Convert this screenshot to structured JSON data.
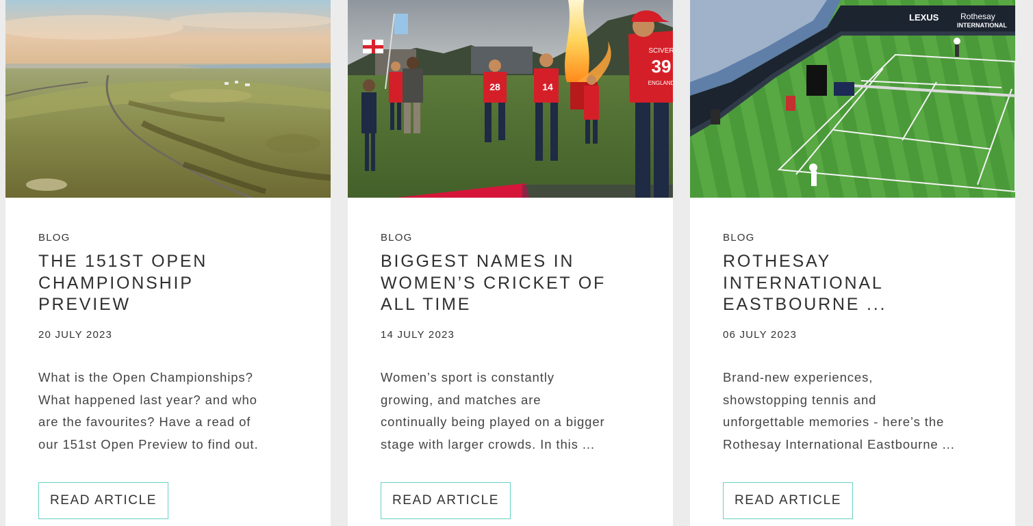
{
  "cards": [
    {
      "category": "BLOG",
      "title_lines": [
        "THE 151ST OPEN",
        "CHAMPIONSHIP",
        "PREVIEW"
      ],
      "date": "20 JULY 2023",
      "excerpt_lines": [
        "What is the Open Championships?",
        "What happened last year? and who",
        "are the favourites? Have a read of",
        "our 151st Open Preview to find out."
      ],
      "button_label": "READ ARTICLE",
      "image_icon": "golf-links-aerial-photo"
    },
    {
      "category": "BLOG",
      "title_lines": [
        "BIGGEST NAMES IN",
        "WOMEN’S CRICKET OF",
        "ALL TIME"
      ],
      "date": "14 JULY 2023",
      "excerpt_lines": [
        "Women’s sport is constantly",
        "growing, and matches are",
        "continually being played on a bigger",
        "stage with larger crowds. In this ..."
      ],
      "button_label": "READ ARTICLE",
      "image_icon": "cricket-players-walkout-photo"
    },
    {
      "category": "BLOG",
      "title_lines": [
        "ROTHESAY",
        "INTERNATIONAL",
        "EASTBOURNE ..."
      ],
      "date": "06 JULY 2023",
      "excerpt_lines": [
        "Brand-new experiences,",
        "showstopping tennis and",
        "unforgettable memories - here’s the",
        "Rothesay International Eastbourne ..."
      ],
      "button_label": "READ ARTICLE",
      "image_icon": "tennis-court-aerial-photo",
      "image_text": {
        "sponsor_left": "LEXUS",
        "sponsor_right_1": "Rothesay",
        "sponsor_right_2": "INTERNATIONAL",
        "shirt_number": "39",
        "shirt_name": "SCIVER",
        "shirt_country": "ENGLAND"
      }
    }
  ],
  "cricket_image_text": {
    "shirt_number": "39",
    "shirt_name": "SCIVER",
    "shirt_country": "ENGLAND",
    "runner_a": "28",
    "runner_b": "14"
  },
  "colors": {
    "page_bg": "#ececec",
    "card_bg": "#ffffff",
    "button_border": "#66d1c3",
    "text": "#333333"
  }
}
